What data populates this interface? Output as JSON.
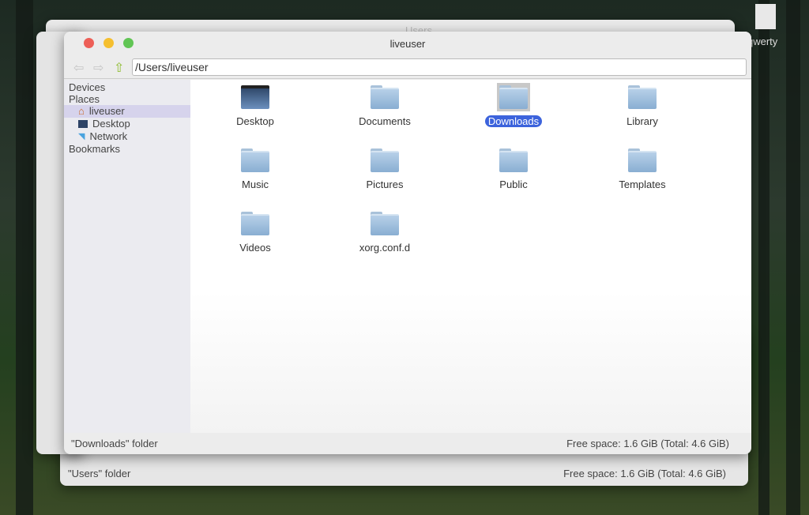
{
  "desktop": {
    "file_label": "qwerty"
  },
  "back_windows": {
    "users_title": "Users",
    "users_status": "\"Users\" folder",
    "users_free": "Free space: 1.6 GiB (Total: 4.6 GiB)"
  },
  "window": {
    "title": "liveuser",
    "path": "/Users/liveuser",
    "sidebar": {
      "devices": "Devices",
      "places": "Places",
      "bookmarks": "Bookmarks",
      "items": [
        {
          "label": "liveuser",
          "icon": "home-icon"
        },
        {
          "label": "Desktop",
          "icon": "desktop-icon"
        },
        {
          "label": "Network",
          "icon": "network-icon"
        }
      ]
    },
    "items": [
      {
        "label": "Desktop"
      },
      {
        "label": "Documents"
      },
      {
        "label": "Downloads",
        "selected": true
      },
      {
        "label": "Library"
      },
      {
        "label": "Music"
      },
      {
        "label": "Pictures"
      },
      {
        "label": "Public"
      },
      {
        "label": "Templates"
      },
      {
        "label": "Videos"
      },
      {
        "label": "xorg.conf.d"
      }
    ],
    "status": "\"Downloads\" folder",
    "free_space": "Free space: 1.6 GiB (Total: 4.6 GiB)"
  },
  "colors": {
    "close": "#ed5f57",
    "minimize": "#f5bf2f",
    "zoom": "#61c554",
    "selection": "#3c63dc"
  }
}
